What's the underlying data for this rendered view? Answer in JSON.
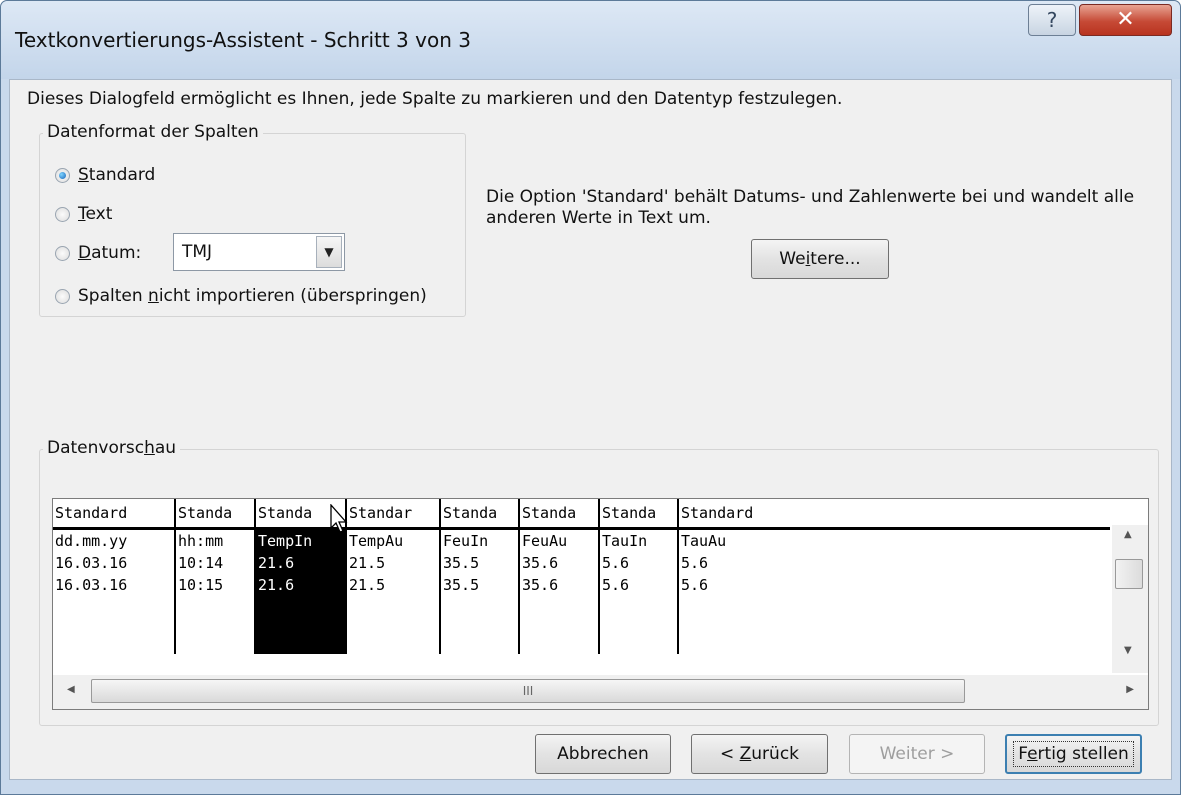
{
  "window": {
    "title": "Textkonvertierungs-Assistent - Schritt 3 von 3",
    "help_symbol": "?",
    "close_symbol": "✕"
  },
  "description": "Dieses Dialogfeld ermöglicht es Ihnen, jede Spalte zu markieren und den Datentyp festzulegen.",
  "format_group": {
    "label": "Datenformat der Spalten",
    "options": {
      "standard": {
        "prefix": "",
        "accel": "S",
        "rest": "tandard",
        "selected": true
      },
      "text": {
        "prefix": "",
        "accel": "T",
        "rest": "ext",
        "selected": false
      },
      "datum": {
        "prefix": "",
        "accel": "D",
        "rest": "atum:",
        "selected": false
      },
      "skip": {
        "prefix": "Spalten ",
        "accel": "n",
        "rest": "icht importieren (überspringen)",
        "selected": false
      }
    },
    "date_format": {
      "value": "TMJ",
      "arrow": "▼"
    }
  },
  "info_text": "Die Option 'Standard' behält Datums- und Zahlenwerte bei und wandelt alle anderen Werte in Text um.",
  "more_button": {
    "prefix": "We",
    "accel": "i",
    "rest": "tere..."
  },
  "preview": {
    "label_prefix": "Datenvorsc",
    "label_accel": "h",
    "label_rest": "au",
    "headers": [
      "Standard",
      "Standa",
      "Standa",
      "Standar",
      "Standa",
      "Standa",
      "Standa",
      "Standard"
    ],
    "rows": [
      [
        "dd.mm.yy",
        "hh:mm",
        "TempIn",
        "TempAu",
        "FeuIn",
        "FeuAu",
        "TauIn",
        "TauAu"
      ],
      [
        "16.03.16",
        "10:14",
        "21.6",
        "21.5",
        "35.5",
        "35.6",
        "5.6",
        "5.6"
      ],
      [
        "16.03.16",
        "10:15",
        "21.6",
        "21.5",
        "35.5",
        "35.6",
        "5.6",
        "5.6"
      ]
    ],
    "selected_column": 2,
    "scroll": {
      "up": "▲",
      "down": "▼",
      "left": "◀",
      "right": "▶",
      "grip": "III"
    }
  },
  "buttons": {
    "cancel": {
      "label": "Abbrechen"
    },
    "back": {
      "prefix": "< ",
      "accel": "Z",
      "rest": "urück"
    },
    "next": {
      "label": "Weiter >"
    },
    "finish": {
      "prefix": "F",
      "accel": "e",
      "rest": "rtig stellen"
    }
  }
}
